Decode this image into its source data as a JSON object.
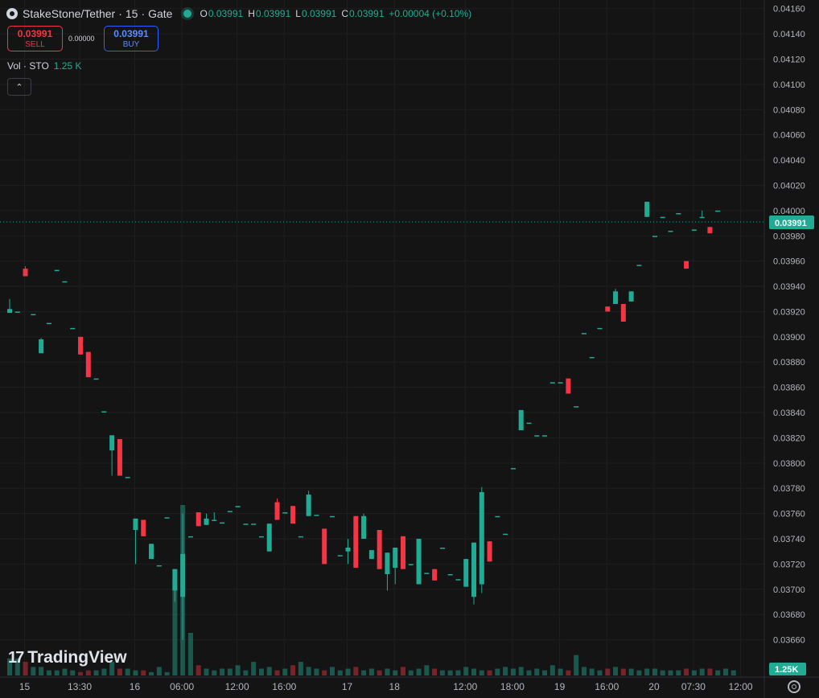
{
  "header": {
    "symbol": "StakeStone/Tether",
    "interval": "15",
    "exchange": "Gate",
    "ohlc": {
      "o_label": "O",
      "o": "0.03991",
      "h_label": "H",
      "h": "0.03991",
      "l_label": "L",
      "l": "0.03991",
      "c_label": "C",
      "c": "0.03991",
      "change": "+0.00004 (+0.10%)"
    }
  },
  "trade": {
    "sell_price": "0.03991",
    "sell_label": "SELL",
    "spread": "0.00000",
    "buy_price": "0.03991",
    "buy_label": "BUY"
  },
  "volume_legend": {
    "label": "Vol · STO",
    "value": "1.25 K"
  },
  "branding": {
    "logo_text": "TradingView"
  },
  "colors": {
    "up": "#22ab94",
    "down": "#f23645",
    "background": "#141414",
    "grid": "#1f1f1f",
    "text": "#d1d4dc"
  },
  "icons": {
    "collapse": "chevron-up-icon",
    "settings": "settings-icon",
    "status": "market-status-dot-icon"
  },
  "chart_data": {
    "type": "candlestick",
    "y_axis": {
      "ticks": [
        "0.04160",
        "0.04140",
        "0.04120",
        "0.04100",
        "0.04080",
        "0.04060",
        "0.04040",
        "0.04020",
        "0.04000",
        "0.03980",
        "0.03960",
        "0.03940",
        "0.03920",
        "0.03900",
        "0.03880",
        "0.03860",
        "0.03840",
        "0.03820",
        "0.03800",
        "0.03780",
        "0.03760",
        "0.03740",
        "0.03720",
        "0.03700",
        "0.03680",
        "0.03660"
      ],
      "range": [
        0.03647,
        0.04163
      ]
    },
    "x_axis": {
      "ticks": [
        "15",
        "13:30",
        "16",
        "06:00",
        "12:00",
        "16:00",
        "17",
        "18",
        "12:00",
        "18:00",
        "19",
        "16:00",
        "20",
        "07:30",
        "12:00"
      ],
      "tick_bars": [
        2,
        9,
        16,
        22,
        29,
        35,
        43,
        49,
        58,
        64,
        70,
        76,
        82,
        87,
        93
      ]
    },
    "last_price": "0.03991",
    "last_volume": "1.25K",
    "candles": [
      [
        0.03919,
        0.0393,
        0.03919,
        0.03922
      ],
      [
        0.0392,
        0.0392,
        0.0392,
        0.0392
      ],
      [
        0.03954,
        0.03956,
        0.03948,
        0.03948
      ],
      [
        0.03918,
        0.03918,
        0.03918,
        0.03918
      ],
      [
        0.03887,
        0.03899,
        0.03887,
        0.03898
      ],
      [
        0.03911,
        0.03911,
        0.03911,
        0.03911
      ],
      [
        0.03953,
        0.03953,
        0.03953,
        0.03953
      ],
      [
        0.03944,
        0.03944,
        0.03944,
        0.03944
      ],
      [
        0.03907,
        0.03907,
        0.03907,
        0.03907
      ],
      [
        0.039,
        0.039,
        0.03886,
        0.03886
      ],
      [
        0.03888,
        0.03888,
        0.03868,
        0.03868
      ],
      [
        0.03867,
        0.03867,
        0.03867,
        0.03867
      ],
      [
        0.03841,
        0.03841,
        0.03841,
        0.03841
      ],
      [
        0.0381,
        0.03822,
        0.0379,
        0.03822
      ],
      [
        0.03819,
        0.03819,
        0.0379,
        0.0379
      ],
      [
        0.03789,
        0.03789,
        0.03789,
        0.03789
      ],
      [
        0.03747,
        0.03756,
        0.0372,
        0.03756
      ],
      [
        0.03755,
        0.03755,
        0.03742,
        0.03742
      ],
      [
        0.03724,
        0.03736,
        0.03724,
        0.03736
      ],
      [
        0.03719,
        0.03719,
        0.03719,
        0.03719
      ],
      [
        0.03757,
        0.03757,
        0.03757,
        0.03757
      ],
      [
        0.03699,
        0.03716,
        0.0369,
        0.03716
      ],
      [
        0.03694,
        0.0376,
        0.0366,
        0.03728
      ],
      [
        0.03742,
        0.03742,
        0.03742,
        0.03742
      ],
      [
        0.03761,
        0.03761,
        0.0375,
        0.0375
      ],
      [
        0.03751,
        0.0376,
        0.03751,
        0.03756
      ],
      [
        0.03755,
        0.03761,
        0.03755,
        0.03755
      ],
      [
        0.03753,
        0.03753,
        0.03753,
        0.03753
      ],
      [
        0.03762,
        0.03762,
        0.03762,
        0.03762
      ],
      [
        0.03766,
        0.03766,
        0.03766,
        0.03766
      ],
      [
        0.03752,
        0.03752,
        0.03752,
        0.03752
      ],
      [
        0.03752,
        0.03752,
        0.03752,
        0.03752
      ],
      [
        0.03742,
        0.03742,
        0.03742,
        0.03742
      ],
      [
        0.0373,
        0.03752,
        0.0373,
        0.03752
      ],
      [
        0.03769,
        0.03772,
        0.03755,
        0.03755
      ],
      [
        0.03761,
        0.03761,
        0.03761,
        0.03761
      ],
      [
        0.03766,
        0.03766,
        0.03752,
        0.03752
      ],
      [
        0.03742,
        0.03742,
        0.03742,
        0.03742
      ],
      [
        0.03758,
        0.03778,
        0.03758,
        0.03775
      ],
      [
        0.03759,
        0.03759,
        0.03759,
        0.03759
      ],
      [
        0.03748,
        0.03748,
        0.0372,
        0.0372
      ],
      [
        0.03758,
        0.03758,
        0.03758,
        0.03758
      ],
      [
        0.03727,
        0.03727,
        0.03727,
        0.03727
      ],
      [
        0.0373,
        0.0374,
        0.0372,
        0.03733
      ],
      [
        0.03758,
        0.03758,
        0.03717,
        0.03717
      ],
      [
        0.0374,
        0.0376,
        0.0374,
        0.03758
      ],
      [
        0.03724,
        0.03731,
        0.03724,
        0.03731
      ],
      [
        0.03747,
        0.03747,
        0.03716,
        0.03716
      ],
      [
        0.03712,
        0.03729,
        0.03699,
        0.03729
      ],
      [
        0.03717,
        0.03733,
        0.03704,
        0.03733
      ],
      [
        0.03742,
        0.03742,
        0.03716,
        0.03716
      ],
      [
        0.0372,
        0.0372,
        0.0372,
        0.0372
      ],
      [
        0.03704,
        0.0374,
        0.03704,
        0.0374
      ],
      [
        0.03713,
        0.03713,
        0.03713,
        0.03713
      ],
      [
        0.03716,
        0.03716,
        0.03707,
        0.03707
      ],
      [
        0.03733,
        0.03733,
        0.03733,
        0.03733
      ],
      [
        0.03712,
        0.03712,
        0.03712,
        0.03712
      ],
      [
        0.03708,
        0.03708,
        0.03708,
        0.03708
      ],
      [
        0.03702,
        0.03724,
        0.03702,
        0.03724
      ],
      [
        0.03694,
        0.03737,
        0.03688,
        0.03737
      ],
      [
        0.03704,
        0.03781,
        0.03697,
        0.03777
      ],
      [
        0.03738,
        0.03738,
        0.03722,
        0.03722
      ],
      [
        0.03758,
        0.03758,
        0.03758,
        0.03758
      ],
      [
        0.03744,
        0.03744,
        0.03744,
        0.03744
      ],
      [
        0.03796,
        0.03796,
        0.03796,
        0.03796
      ],
      [
        0.03826,
        0.03842,
        0.03826,
        0.03842
      ],
      [
        0.03832,
        0.03832,
        0.03832,
        0.03832
      ],
      [
        0.03822,
        0.03822,
        0.03822,
        0.03822
      ],
      [
        0.03822,
        0.03822,
        0.03822,
        0.03822
      ],
      [
        0.03864,
        0.03864,
        0.03864,
        0.03864
      ],
      [
        0.03864,
        0.03864,
        0.03864,
        0.03864
      ],
      [
        0.03867,
        0.03867,
        0.03855,
        0.03855
      ],
      [
        0.03845,
        0.03845,
        0.03845,
        0.03845
      ],
      [
        0.03903,
        0.03903,
        0.03903,
        0.03903
      ],
      [
        0.03884,
        0.03884,
        0.03884,
        0.03884
      ],
      [
        0.03907,
        0.03907,
        0.03907,
        0.03907
      ],
      [
        0.03924,
        0.03924,
        0.0392,
        0.0392
      ],
      [
        0.03926,
        0.03938,
        0.03926,
        0.03936
      ],
      [
        0.03926,
        0.03926,
        0.03912,
        0.03912
      ],
      [
        0.03928,
        0.03936,
        0.03928,
        0.03936
      ],
      [
        0.03957,
        0.03957,
        0.03957,
        0.03957
      ],
      [
        0.03995,
        0.04007,
        0.03995,
        0.04007
      ],
      [
        0.0398,
        0.0398,
        0.0398,
        0.0398
      ],
      [
        0.03995,
        0.03995,
        0.03995,
        0.03995
      ],
      [
        0.03984,
        0.03984,
        0.03984,
        0.03984
      ],
      [
        0.03998,
        0.03998,
        0.03998,
        0.03998
      ],
      [
        0.0396,
        0.0396,
        0.03954,
        0.03954
      ],
      [
        0.03985,
        0.03985,
        0.03985,
        0.03985
      ],
      [
        0.03995,
        0.04,
        0.03995,
        0.03995
      ],
      [
        0.03987,
        0.03987,
        0.03982,
        0.03982
      ],
      [
        0.04,
        0.04,
        0.04,
        0.04
      ]
    ],
    "volume": {
      "values": [
        10,
        10,
        8,
        5,
        5,
        3,
        3,
        4,
        3,
        2,
        3,
        3,
        4,
        8,
        4,
        4,
        3,
        3,
        2,
        5,
        2,
        55,
        100,
        25,
        6,
        4,
        3,
        4,
        4,
        6,
        3,
        8,
        4,
        5,
        3,
        4,
        6,
        8,
        5,
        4,
        3,
        5,
        3,
        4,
        5,
        3,
        4,
        3,
        4,
        3,
        5,
        3,
        4,
        6,
        4,
        3,
        3,
        3,
        5,
        4,
        3,
        3,
        4,
        5,
        4,
        5,
        3,
        4,
        3,
        6,
        4,
        3,
        12,
        5,
        4,
        3,
        4,
        5,
        4,
        4,
        3,
        4,
        4,
        3,
        3,
        3,
        4,
        3,
        4,
        4,
        3,
        4,
        3
      ],
      "scale_max": 100
    }
  }
}
